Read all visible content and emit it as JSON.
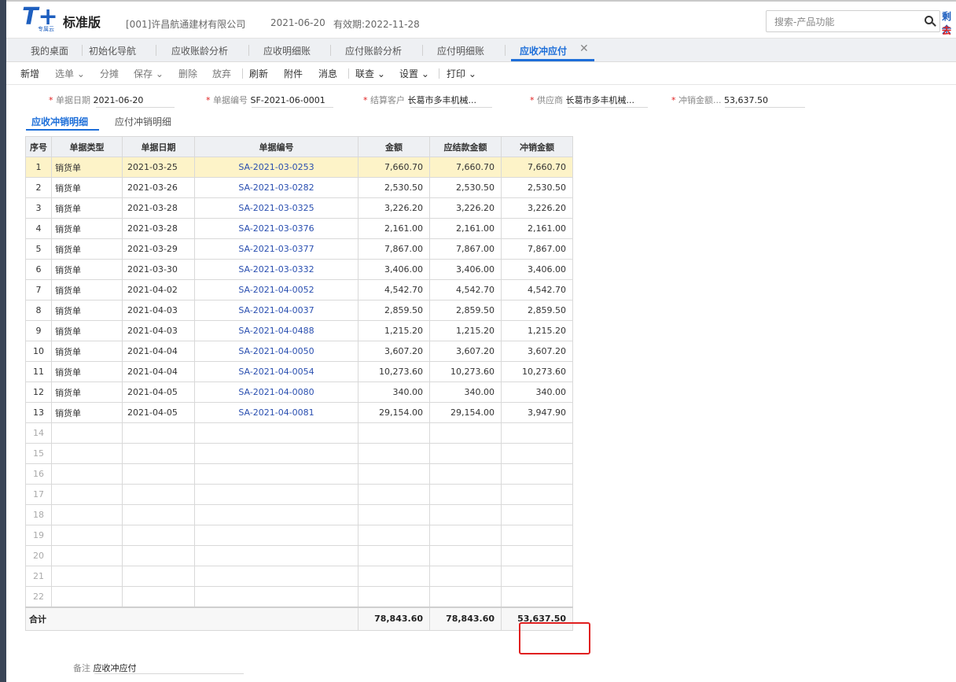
{
  "header": {
    "logo_letters": "T+",
    "logo_sub": "专属云",
    "edition": "标准版",
    "company": "[001]许昌航通建材有限公司",
    "date": "2021-06-20",
    "validity": "有效期:2022-11-28",
    "search_placeholder": "搜索-产品功能",
    "corner_top": "剩余",
    "corner_bottom": "去"
  },
  "tabs": [
    {
      "label": "我的桌面"
    },
    {
      "label": "初始化导航"
    },
    {
      "label": "应收账龄分析"
    },
    {
      "label": "应收明细账"
    },
    {
      "label": "应付账龄分析"
    },
    {
      "label": "应付明细账"
    },
    {
      "label": "应收冲应付",
      "active": true
    }
  ],
  "toolbar": [
    {
      "label": "新增"
    },
    {
      "label": "选单"
    },
    {
      "label": "分摊"
    },
    {
      "label": "保存"
    },
    {
      "label": "删除"
    },
    {
      "label": "放弃"
    },
    {
      "label": "刷新"
    },
    {
      "label": "附件"
    },
    {
      "label": "消息"
    },
    {
      "label": "联查"
    },
    {
      "label": "设置"
    },
    {
      "label": "打印"
    }
  ],
  "form": {
    "doc_date_label": "单据日期",
    "doc_date": "2021-06-20",
    "doc_no_label": "单据编号",
    "doc_no": "SF-2021-06-0001",
    "customer_label": "结算客户",
    "customer": "长葛市多丰机械...",
    "supplier_label": "供应商",
    "supplier": "长葛市多丰机械...",
    "amount_label": "冲销金额...",
    "amount": "53,637.50"
  },
  "subtabs": [
    {
      "label": "应收冲销明细",
      "active": true
    },
    {
      "label": "应付冲销明细"
    }
  ],
  "grid": {
    "columns": [
      "序号",
      "单据类型",
      "单据日期",
      "单据编号",
      "金额",
      "应结款金额",
      "冲销金额"
    ],
    "rows": [
      {
        "seq": "1",
        "type": "销货单",
        "date": "2021-03-25",
        "no": "SA-2021-03-0253",
        "amount": "7,660.70",
        "due": "7,660.70",
        "offset": "7,660.70"
      },
      {
        "seq": "2",
        "type": "销货单",
        "date": "2021-03-26",
        "no": "SA-2021-03-0282",
        "amount": "2,530.50",
        "due": "2,530.50",
        "offset": "2,530.50"
      },
      {
        "seq": "3",
        "type": "销货单",
        "date": "2021-03-28",
        "no": "SA-2021-03-0325",
        "amount": "3,226.20",
        "due": "3,226.20",
        "offset": "3,226.20"
      },
      {
        "seq": "4",
        "type": "销货单",
        "date": "2021-03-28",
        "no": "SA-2021-03-0376",
        "amount": "2,161.00",
        "due": "2,161.00",
        "offset": "2,161.00"
      },
      {
        "seq": "5",
        "type": "销货单",
        "date": "2021-03-29",
        "no": "SA-2021-03-0377",
        "amount": "7,867.00",
        "due": "7,867.00",
        "offset": "7,867.00"
      },
      {
        "seq": "6",
        "type": "销货单",
        "date": "2021-03-30",
        "no": "SA-2021-03-0332",
        "amount": "3,406.00",
        "due": "3,406.00",
        "offset": "3,406.00"
      },
      {
        "seq": "7",
        "type": "销货单",
        "date": "2021-04-02",
        "no": "SA-2021-04-0052",
        "amount": "4,542.70",
        "due": "4,542.70",
        "offset": "4,542.70"
      },
      {
        "seq": "8",
        "type": "销货单",
        "date": "2021-04-03",
        "no": "SA-2021-04-0037",
        "amount": "2,859.50",
        "due": "2,859.50",
        "offset": "2,859.50"
      },
      {
        "seq": "9",
        "type": "销货单",
        "date": "2021-04-03",
        "no": "SA-2021-04-0488",
        "amount": "1,215.20",
        "due": "1,215.20",
        "offset": "1,215.20"
      },
      {
        "seq": "10",
        "type": "销货单",
        "date": "2021-04-04",
        "no": "SA-2021-04-0050",
        "amount": "3,607.20",
        "due": "3,607.20",
        "offset": "3,607.20"
      },
      {
        "seq": "11",
        "type": "销货单",
        "date": "2021-04-04",
        "no": "SA-2021-04-0054",
        "amount": "10,273.60",
        "due": "10,273.60",
        "offset": "10,273.60"
      },
      {
        "seq": "12",
        "type": "销货单",
        "date": "2021-04-05",
        "no": "SA-2021-04-0080",
        "amount": "340.00",
        "due": "340.00",
        "offset": "340.00"
      },
      {
        "seq": "13",
        "type": "销货单",
        "date": "2021-04-05",
        "no": "SA-2021-04-0081",
        "amount": "29,154.00",
        "due": "29,154.00",
        "offset": "3,947.90"
      }
    ],
    "empty_rows": [
      "14",
      "15",
      "16",
      "17",
      "18",
      "19",
      "20",
      "21",
      "22"
    ],
    "total": {
      "label": "合计",
      "amount": "78,843.60",
      "due": "78,843.60",
      "offset": "53,637.50"
    }
  },
  "remark": {
    "label": "备注",
    "value": "应收冲应付"
  },
  "colors": {
    "accent": "#1e6fd9",
    "selected_row": "#fdf3c8",
    "highlight": "#e02020",
    "link": "#2a4fb0"
  }
}
